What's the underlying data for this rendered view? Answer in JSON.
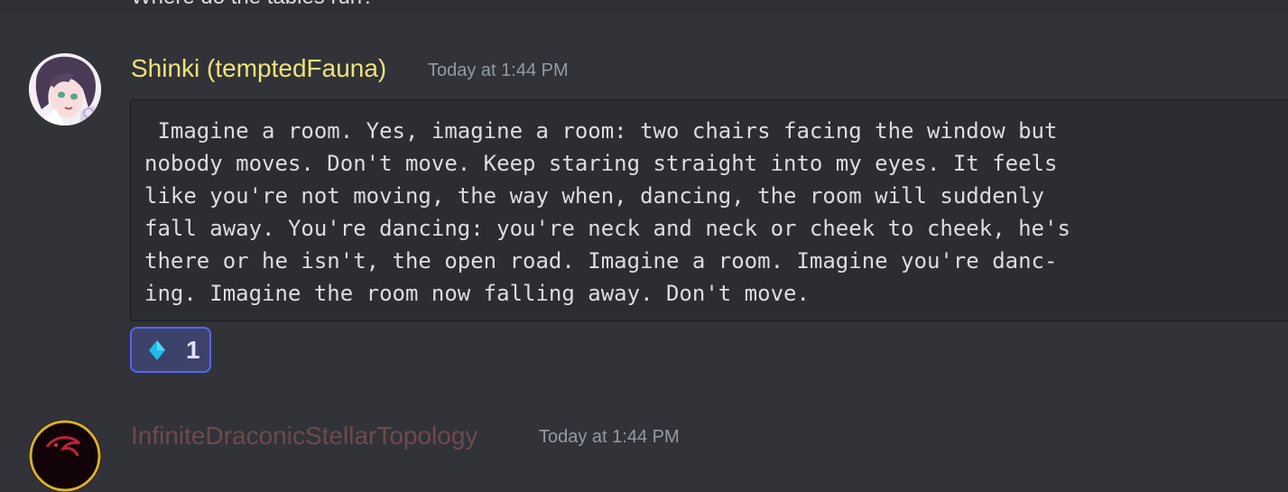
{
  "previous_message": {
    "text": "Where do the tables run?"
  },
  "message": {
    "username": "Shinki (temptedFauna)",
    "timestamp": "Today at 1:44 PM",
    "username_color": "#f0e27a",
    "avatar_icon": "anime-character-avatar",
    "code_text": " Imagine a room. Yes, imagine a room: two chairs facing the window but\nnobody moves. Don't move. Keep staring straight into my eyes. It feels\nlike you're not moving, the way when, dancing, the room will suddenly\nfall away. You're dancing: you're neck and neck or cheek to cheek, he's\nthere or he isn't, the open road. Imagine a room. Imagine you're danc-\ning. Imagine the room now falling away. Don't move.",
    "reaction": {
      "emoji_icon": "blue-diamond-icon",
      "count": "1",
      "accent_color": "#5865f2"
    }
  },
  "next_message": {
    "username": "InfiniteDraconicStellarTopology",
    "timestamp": "Today at 1:44 PM",
    "username_color": "#6c4a4f",
    "avatar_icon": "dragon-avatar"
  }
}
